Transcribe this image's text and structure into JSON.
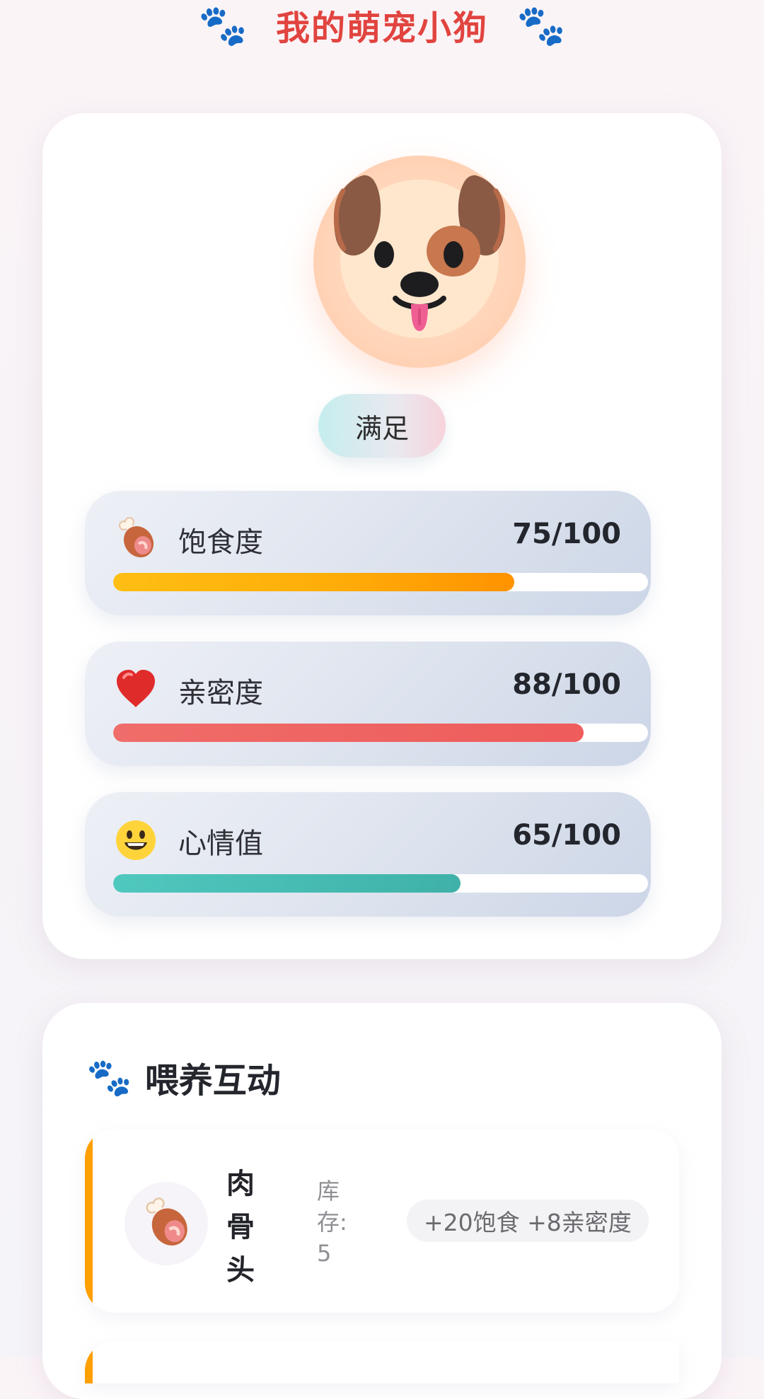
{
  "header": {
    "title": "我的萌宠小狗",
    "left_icon": "paw-icon",
    "right_icon": "paw-icon",
    "title_color": "#e1443f",
    "icon_color": "#1e6dc9"
  },
  "pet": {
    "avatar_icon": "dog-face-icon",
    "mood": "满足"
  },
  "stats": [
    {
      "icon": "meat-on-bone-icon",
      "label": "饱食度",
      "value_text": "75/100",
      "value": 75,
      "max": 100,
      "bar_color": "#ffad08"
    },
    {
      "icon": "heart-icon",
      "label": "亲密度",
      "value_text": "88/100",
      "value": 88,
      "max": 100,
      "bar_color": "#ee5c5b"
    },
    {
      "icon": "smiling-face-icon",
      "label": "心情值",
      "value_text": "65/100",
      "value": 65,
      "max": 100,
      "bar_color": "#3fb1a8"
    }
  ],
  "feed_section": {
    "title": "喂养互动",
    "title_icon": "paw-icon",
    "items": [
      {
        "icon": "meat-on-bone-icon",
        "name": "肉骨头",
        "stock": "库存: 5",
        "effect": "+20饱食 +8亲密度",
        "accent_color": "#ff9f00"
      }
    ]
  }
}
